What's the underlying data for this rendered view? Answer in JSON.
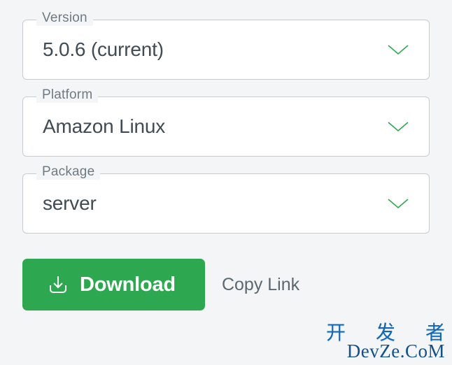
{
  "fields": {
    "version": {
      "label": "Version",
      "value": "5.0.6 (current)"
    },
    "platform": {
      "label": "Platform",
      "value": "Amazon Linux"
    },
    "package": {
      "label": "Package",
      "value": "server"
    }
  },
  "actions": {
    "download_label": "Download",
    "copy_link_label": "Copy Link"
  },
  "watermark": {
    "cn": "开 发 者",
    "en": "DevZe.CoM"
  },
  "colors": {
    "accent": "#2ea850",
    "chevron": "#2ea850"
  }
}
